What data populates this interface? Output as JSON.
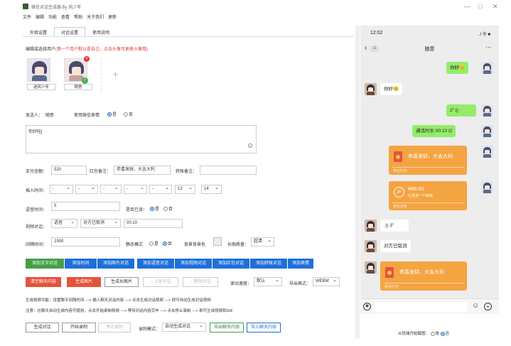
{
  "app": {
    "title": "微信对话生成器 By 风少年"
  },
  "menu": [
    "文件",
    "编辑",
    "功能",
    "查看",
    "帮助",
    "关于我们",
    "更新"
  ],
  "tabs": [
    "外观设置",
    "对话设置",
    "使用说明"
  ],
  "panel": {
    "title": "编辑或选择用户",
    "warning": "(第一个用户默认是自己，点击头像可更换头像哦)"
  },
  "users": [
    {
      "name": "迷风少年"
    },
    {
      "name": "随意"
    }
  ],
  "sender": {
    "label": "发送人：",
    "value": "随意",
    "emoji_label": "使用微信表情",
    "yes": "是",
    "no": "否"
  },
  "message": {
    "value": "你好哇["
  },
  "money": {
    "amount_label": "支付金额：",
    "amount": "520",
    "note_label": "红包备注：",
    "note": "恭喜发财，大吉大利",
    "remark_label": "转账备注："
  },
  "insert_time": {
    "label": "插入时间：",
    "hour": "13",
    "minute": "14"
  },
  "voice": {
    "label": "语音时间：",
    "value": "5",
    "read_label": "是否已读：",
    "yes": "是",
    "no": "否"
  },
  "video": {
    "label": "视频对话：",
    "type": "语音",
    "status": "对方已取消",
    "duration": "00:10"
  },
  "interval": {
    "label": "间隔时间：",
    "value": "1500",
    "dark_label": "静态模式",
    "on": "是",
    "off": "否",
    "bg_label": "背景背景色",
    "bg_mode_label": "长图质量：",
    "bg_mode": "超清"
  },
  "actions_row1": [
    "添加文字对话",
    "添加时间",
    "添加图片对话",
    "添加语音对话",
    "添加视频对话",
    "添加红包对话",
    "添加转账对话",
    "添加表情"
  ],
  "actions_row2": {
    "clear": "清空聊天内容",
    "gen_img": "生成图片",
    "gen_long": "生成长图片",
    "up": "↑ 上移对话",
    "down": "↓ 删除对话",
    "browser_label": "滚动速度：",
    "browser_value": "默认",
    "format_label": "导出格式：",
    "format_value": "WEBM"
  },
  "help": [
    "生成视频功能：设置聊天间隔时间 ---> 输入聊天对话内容 ---> 点击生成对话视频 ---> 即可自动生成对话视频",
    "注意：在聊天自动生成内容可使用，点击开始录制视频 ---> 等待对话内容完毕 ---> 点击停止录制 ---> 即可生成视频和GIF"
  ],
  "bottom": {
    "generate": "生成对话",
    "start_record": "开始录制",
    "stop_record": "停止录制",
    "mode_label": "录制模式：",
    "mode_value": "自动生成对话",
    "export": "导出聊天内容",
    "import": "导入聊天内容"
  },
  "phone": {
    "time": "12:02",
    "signal": "..l 令 ■",
    "unread": "1",
    "title": "随意",
    "more": "···",
    "msg_hello_me": "你好😊",
    "msg_hello_other": "你好😊",
    "voice_me": "2\" ((·",
    "call_me": "通话时长 00:10 ⊡",
    "redpacket_text": "恭喜发财，大吉大利",
    "redpacket_foot": "微信红包",
    "transfer_amount": "¥88.00",
    "transfer_sub": "已发送一个转账",
    "transfer_foot": "微信转账",
    "voice_other": "·)) 3\"",
    "call_other": "对方已取消",
    "redpacket2_text": "恭喜发财，大吉大利",
    "redpacket2_foot": "微信红包"
  },
  "phone_footer": {
    "label": "从低端开始截图：",
    "yes": "是",
    "no": "否"
  },
  "colors": {
    "green": "#43a047",
    "blue": "#1e6fd9",
    "red": "#e5533d",
    "wechat_bubble": "#95ec69",
    "redpacket": "#f5a442"
  }
}
